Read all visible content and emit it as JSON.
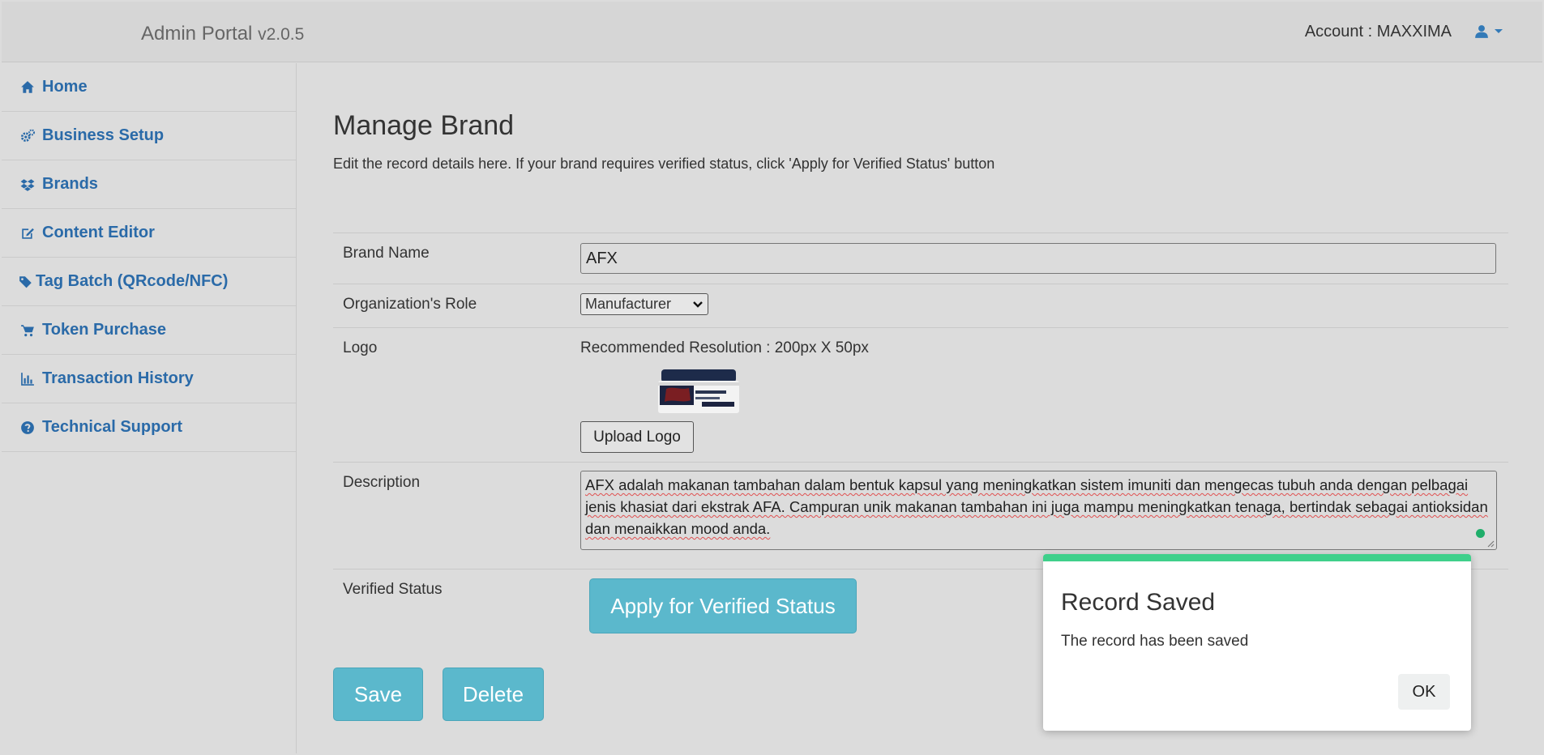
{
  "header": {
    "app_title": "Admin Portal",
    "version": "v2.0.5",
    "account_label": "Account : MAXXIMA",
    "user_icon": "user-icon"
  },
  "sidebar": {
    "items": [
      {
        "label": "Home",
        "icon": "home-icon"
      },
      {
        "label": "Business Setup",
        "icon": "cogs-icon"
      },
      {
        "label": "Brands",
        "icon": "dropbox-icon"
      },
      {
        "label": "Content Editor",
        "icon": "edit-icon"
      },
      {
        "label": "Tag Batch (QRcode/NFC)",
        "icon": "tags-icon"
      },
      {
        "label": "Token Purchase",
        "icon": "cart-icon"
      },
      {
        "label": "Transaction History",
        "icon": "bar-chart-icon"
      },
      {
        "label": "Technical Support",
        "icon": "question-circle-icon"
      }
    ]
  },
  "main": {
    "title": "Manage Brand",
    "subtitle": "Edit the record details here. If your brand requires verified status, click 'Apply for Verified Status' button",
    "form": {
      "brand_name_label": "Brand Name",
      "brand_name_value": "AFX",
      "role_label": "Organization's Role",
      "role_value": "Manufacturer",
      "logo_label": "Logo",
      "logo_resolution": "Recommended Resolution : 200px X 50px",
      "upload_label": "Upload Logo",
      "description_label": "Description",
      "description_value": "AFX adalah makanan tambahan dalam bentuk kapsul yang meningkatkan sistem imuniti dan mengecas tubuh anda dengan pelbagai jenis khasiat dari ekstrak AFA. Campuran unik makanan tambahan ini juga mampu meningkatkan tenaga, bertindak sebagai antioksidan dan menaikkan mood anda.",
      "verified_label": "Verified Status",
      "verify_button": "Apply for Verified Status"
    },
    "save_button": "Save",
    "delete_button": "Delete"
  },
  "dialog": {
    "title": "Record Saved",
    "message": "The record has been saved",
    "ok_label": "OK",
    "accent_color": "#3fd08b"
  },
  "colors": {
    "link": "#2a6aa8",
    "button": "#5bb8cc"
  }
}
